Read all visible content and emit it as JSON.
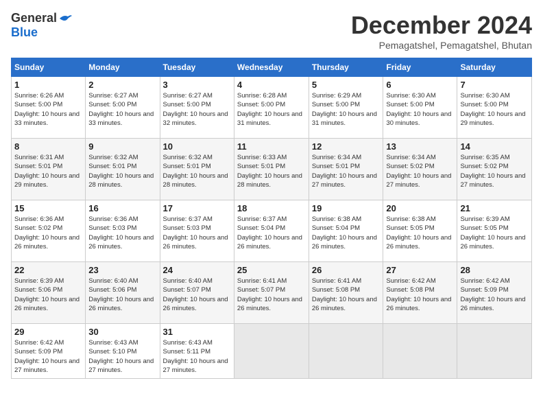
{
  "logo": {
    "general": "General",
    "blue": "Blue"
  },
  "title": "December 2024",
  "subtitle": "Pemagatshel, Pemagatshel, Bhutan",
  "headers": [
    "Sunday",
    "Monday",
    "Tuesday",
    "Wednesday",
    "Thursday",
    "Friday",
    "Saturday"
  ],
  "weeks": [
    [
      {
        "day": "1",
        "sunrise": "Sunrise: 6:26 AM",
        "sunset": "Sunset: 5:00 PM",
        "daylight": "Daylight: 10 hours and 33 minutes."
      },
      {
        "day": "2",
        "sunrise": "Sunrise: 6:27 AM",
        "sunset": "Sunset: 5:00 PM",
        "daylight": "Daylight: 10 hours and 33 minutes."
      },
      {
        "day": "3",
        "sunrise": "Sunrise: 6:27 AM",
        "sunset": "Sunset: 5:00 PM",
        "daylight": "Daylight: 10 hours and 32 minutes."
      },
      {
        "day": "4",
        "sunrise": "Sunrise: 6:28 AM",
        "sunset": "Sunset: 5:00 PM",
        "daylight": "Daylight: 10 hours and 31 minutes."
      },
      {
        "day": "5",
        "sunrise": "Sunrise: 6:29 AM",
        "sunset": "Sunset: 5:00 PM",
        "daylight": "Daylight: 10 hours and 31 minutes."
      },
      {
        "day": "6",
        "sunrise": "Sunrise: 6:30 AM",
        "sunset": "Sunset: 5:00 PM",
        "daylight": "Daylight: 10 hours and 30 minutes."
      },
      {
        "day": "7",
        "sunrise": "Sunrise: 6:30 AM",
        "sunset": "Sunset: 5:00 PM",
        "daylight": "Daylight: 10 hours and 29 minutes."
      }
    ],
    [
      {
        "day": "8",
        "sunrise": "Sunrise: 6:31 AM",
        "sunset": "Sunset: 5:01 PM",
        "daylight": "Daylight: 10 hours and 29 minutes."
      },
      {
        "day": "9",
        "sunrise": "Sunrise: 6:32 AM",
        "sunset": "Sunset: 5:01 PM",
        "daylight": "Daylight: 10 hours and 28 minutes."
      },
      {
        "day": "10",
        "sunrise": "Sunrise: 6:32 AM",
        "sunset": "Sunset: 5:01 PM",
        "daylight": "Daylight: 10 hours and 28 minutes."
      },
      {
        "day": "11",
        "sunrise": "Sunrise: 6:33 AM",
        "sunset": "Sunset: 5:01 PM",
        "daylight": "Daylight: 10 hours and 28 minutes."
      },
      {
        "day": "12",
        "sunrise": "Sunrise: 6:34 AM",
        "sunset": "Sunset: 5:01 PM",
        "daylight": "Daylight: 10 hours and 27 minutes."
      },
      {
        "day": "13",
        "sunrise": "Sunrise: 6:34 AM",
        "sunset": "Sunset: 5:02 PM",
        "daylight": "Daylight: 10 hours and 27 minutes."
      },
      {
        "day": "14",
        "sunrise": "Sunrise: 6:35 AM",
        "sunset": "Sunset: 5:02 PM",
        "daylight": "Daylight: 10 hours and 27 minutes."
      }
    ],
    [
      {
        "day": "15",
        "sunrise": "Sunrise: 6:36 AM",
        "sunset": "Sunset: 5:02 PM",
        "daylight": "Daylight: 10 hours and 26 minutes."
      },
      {
        "day": "16",
        "sunrise": "Sunrise: 6:36 AM",
        "sunset": "Sunset: 5:03 PM",
        "daylight": "Daylight: 10 hours and 26 minutes."
      },
      {
        "day": "17",
        "sunrise": "Sunrise: 6:37 AM",
        "sunset": "Sunset: 5:03 PM",
        "daylight": "Daylight: 10 hours and 26 minutes."
      },
      {
        "day": "18",
        "sunrise": "Sunrise: 6:37 AM",
        "sunset": "Sunset: 5:04 PM",
        "daylight": "Daylight: 10 hours and 26 minutes."
      },
      {
        "day": "19",
        "sunrise": "Sunrise: 6:38 AM",
        "sunset": "Sunset: 5:04 PM",
        "daylight": "Daylight: 10 hours and 26 minutes."
      },
      {
        "day": "20",
        "sunrise": "Sunrise: 6:38 AM",
        "sunset": "Sunset: 5:05 PM",
        "daylight": "Daylight: 10 hours and 26 minutes."
      },
      {
        "day": "21",
        "sunrise": "Sunrise: 6:39 AM",
        "sunset": "Sunset: 5:05 PM",
        "daylight": "Daylight: 10 hours and 26 minutes."
      }
    ],
    [
      {
        "day": "22",
        "sunrise": "Sunrise: 6:39 AM",
        "sunset": "Sunset: 5:06 PM",
        "daylight": "Daylight: 10 hours and 26 minutes."
      },
      {
        "day": "23",
        "sunrise": "Sunrise: 6:40 AM",
        "sunset": "Sunset: 5:06 PM",
        "daylight": "Daylight: 10 hours and 26 minutes."
      },
      {
        "day": "24",
        "sunrise": "Sunrise: 6:40 AM",
        "sunset": "Sunset: 5:07 PM",
        "daylight": "Daylight: 10 hours and 26 minutes."
      },
      {
        "day": "25",
        "sunrise": "Sunrise: 6:41 AM",
        "sunset": "Sunset: 5:07 PM",
        "daylight": "Daylight: 10 hours and 26 minutes."
      },
      {
        "day": "26",
        "sunrise": "Sunrise: 6:41 AM",
        "sunset": "Sunset: 5:08 PM",
        "daylight": "Daylight: 10 hours and 26 minutes."
      },
      {
        "day": "27",
        "sunrise": "Sunrise: 6:42 AM",
        "sunset": "Sunset: 5:08 PM",
        "daylight": "Daylight: 10 hours and 26 minutes."
      },
      {
        "day": "28",
        "sunrise": "Sunrise: 6:42 AM",
        "sunset": "Sunset: 5:09 PM",
        "daylight": "Daylight: 10 hours and 26 minutes."
      }
    ],
    [
      {
        "day": "29",
        "sunrise": "Sunrise: 6:42 AM",
        "sunset": "Sunset: 5:09 PM",
        "daylight": "Daylight: 10 hours and 27 minutes."
      },
      {
        "day": "30",
        "sunrise": "Sunrise: 6:43 AM",
        "sunset": "Sunset: 5:10 PM",
        "daylight": "Daylight: 10 hours and 27 minutes."
      },
      {
        "day": "31",
        "sunrise": "Sunrise: 6:43 AM",
        "sunset": "Sunset: 5:11 PM",
        "daylight": "Daylight: 10 hours and 27 minutes."
      },
      null,
      null,
      null,
      null
    ]
  ]
}
